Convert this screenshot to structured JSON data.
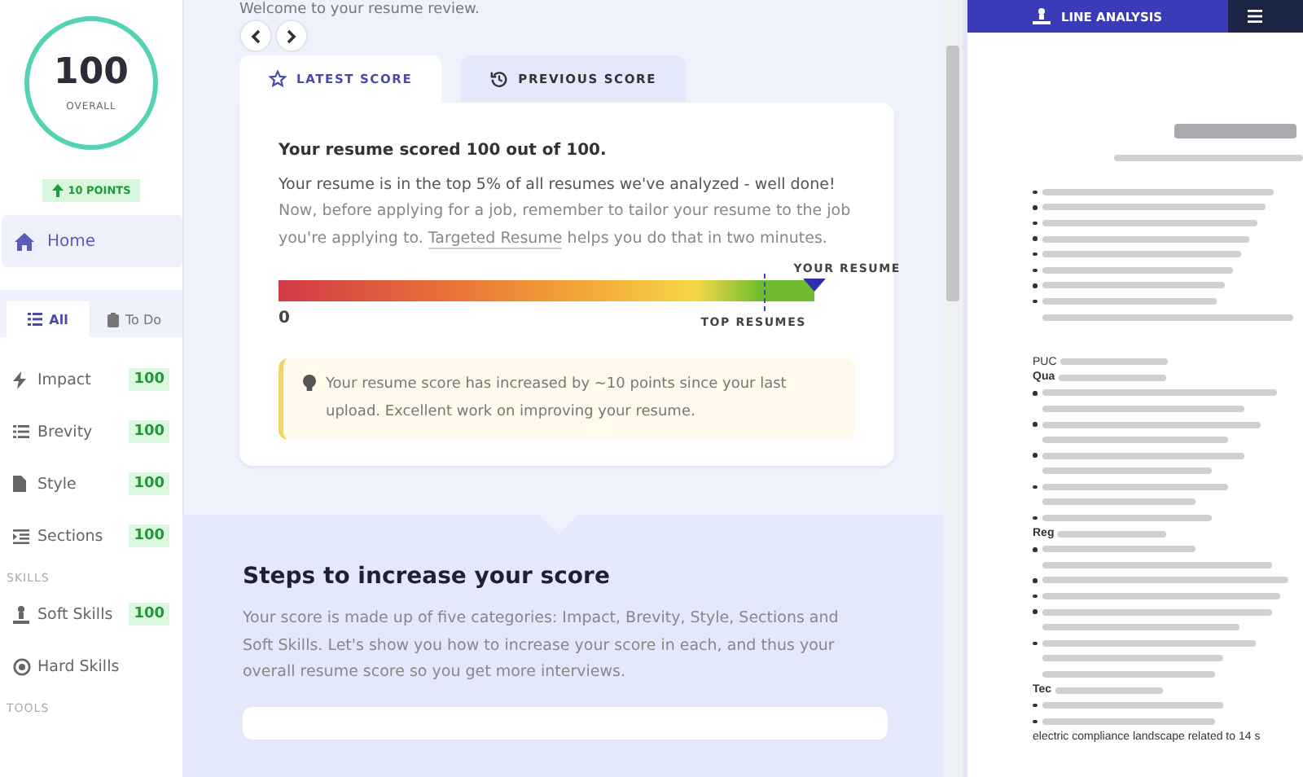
{
  "sidebar": {
    "score": {
      "value": "100",
      "label": "OVERALL",
      "change": "10 POINTS"
    },
    "home": {
      "label": "Home",
      "selected": true
    },
    "filter_tabs": [
      {
        "label": "All",
        "selected": true
      },
      {
        "label": "To Do",
        "selected": false
      }
    ],
    "groups": [
      {
        "items": [
          {
            "label": "Impact",
            "score": "100"
          },
          {
            "label": "Brevity",
            "score": "100"
          },
          {
            "label": "Style",
            "score": "100"
          },
          {
            "label": "Sections",
            "score": "100"
          }
        ]
      },
      {
        "heading": "SKILLS",
        "items": [
          {
            "label": "Soft Skills",
            "score": "100"
          },
          {
            "label": "Hard Skills"
          }
        ]
      },
      {
        "heading": "TOOLS"
      }
    ]
  },
  "main": {
    "welcome": "Welcome to your resume review.",
    "score_tabs": [
      {
        "label": "LATEST SCORE",
        "selected": true
      },
      {
        "label": "PREVIOUS SCORE",
        "selected": false
      }
    ],
    "headline": "Your resume scored 100 out of 100.",
    "body": "Your resume is in the top 5% of all resumes we've analyzed - well done!",
    "body_2_before": "Now, before applying for a job, remember to tailor your resume to the job you're applying to.",
    "link": "Targeted Resume",
    "body_2_after": "helps you do that in two minutes.",
    "meter": {
      "your_label": "YOUR RESUME",
      "level": 1,
      "top_label": "TOP RESUMES",
      "min_label": "0"
    },
    "tip": "Your resume score has increased by ~10 points since your last upload. Excellent work on improving your resume.",
    "steps_title": "Steps to increase your score",
    "steps_text": "Your score is made up of five categories: Impact, Brevity, Style, Sections and Soft Skills. Let's show you how to increase your score in each, and thus your overall resume score so you get more interviews."
  },
  "right_panel": {
    "tabs": [
      {
        "label": "LINE ANALYSIS",
        "selected": true
      },
      {
        "selected": false
      }
    ],
    "document_lines": [
      {
        "kind": "title"
      },
      {
        "kind": "sub"
      },
      {
        "kind": "gap"
      },
      {
        "kind": "bullet"
      },
      {
        "kind": "bullet"
      },
      {
        "kind": "bullet"
      },
      {
        "kind": "bullet"
      },
      {
        "kind": "bullet"
      },
      {
        "kind": "bullet"
      },
      {
        "kind": "bullet"
      },
      {
        "kind": "bullet"
      },
      {
        "kind": "cont"
      },
      {
        "kind": "gap"
      },
      {
        "kind": "gap"
      },
      {
        "kind": "plain",
        "text": "PUC"
      },
      {
        "kind": "bold",
        "text": "Qua"
      },
      {
        "kind": "bullet"
      },
      {
        "kind": "cont"
      },
      {
        "kind": "bullet"
      },
      {
        "kind": "cont"
      },
      {
        "kind": "bullet"
      },
      {
        "kind": "cont"
      },
      {
        "kind": "bullet"
      },
      {
        "kind": "cont"
      },
      {
        "kind": "bullet"
      },
      {
        "kind": "bold",
        "text": "Reg"
      },
      {
        "kind": "bullet"
      },
      {
        "kind": "cont"
      },
      {
        "kind": "bullet"
      },
      {
        "kind": "bullet"
      },
      {
        "kind": "bullet"
      },
      {
        "kind": "cont"
      },
      {
        "kind": "bullet"
      },
      {
        "kind": "cont"
      },
      {
        "kind": "cont"
      },
      {
        "kind": "bold",
        "text": "Tec"
      },
      {
        "kind": "bullet"
      },
      {
        "kind": "bullet"
      },
      {
        "kind": "line",
        "text": "electric compliance landscape related to 14 s"
      }
    ]
  }
}
